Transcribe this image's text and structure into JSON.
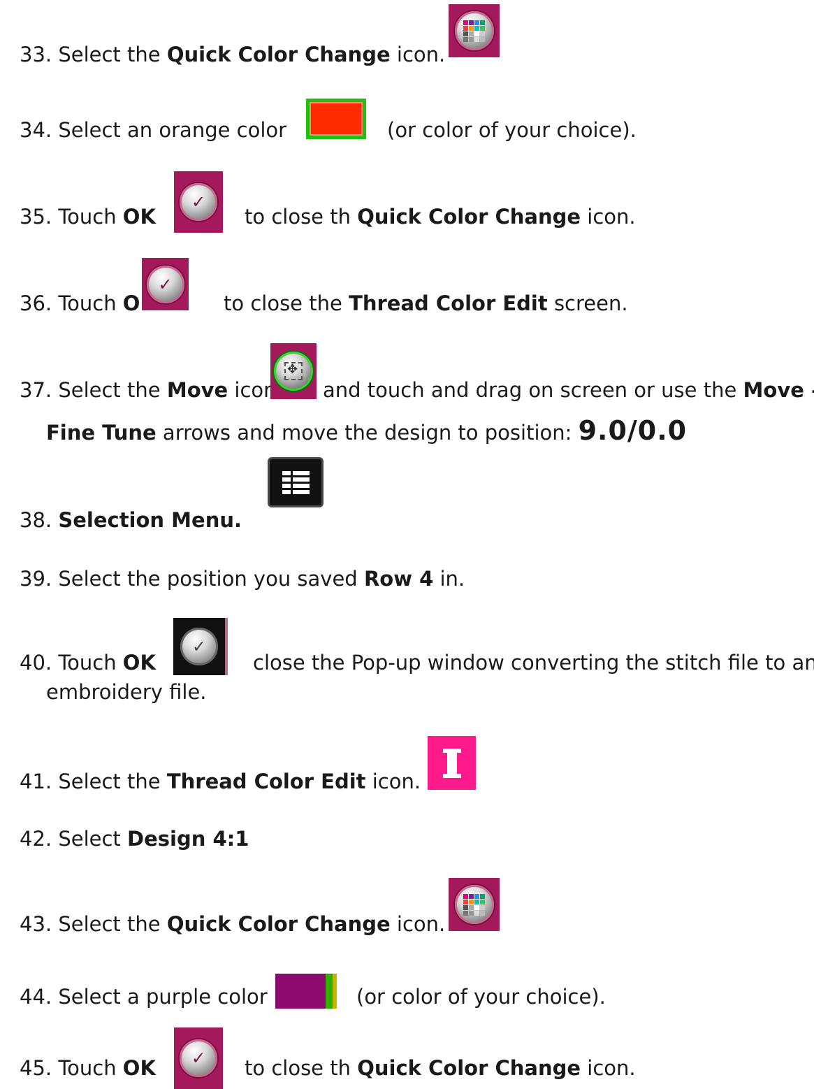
{
  "steps": [
    {
      "num": "33. ",
      "t1": "Select the ",
      "b1": "Quick Color Change",
      "t2": " icon."
    },
    {
      "num": "34. ",
      "t1": "Select an orange color",
      "t2": "(or color of your choice)."
    },
    {
      "num": "35. ",
      "t1": "Touch ",
      "b1": "OK",
      "t2": "to close th ",
      "b2": "Quick Color Change",
      "t3": " icon."
    },
    {
      "num": "36. ",
      "t1": "Touch ",
      "b1": "OK",
      "t2": "to close the ",
      "b2": "Thread Color Edit",
      "t3": " screen."
    },
    {
      "num": "37. ",
      "t1": "Select the ",
      "b1": "Move",
      "t2": " icon",
      "t3": "and touch and drag on screen or use the ",
      "b2": "Move –",
      "line2_b": "Fine Tune",
      "line2_t": " arrows and move the design to position:  ",
      "line2_big": "9.0/0.0"
    },
    {
      "num": "38. ",
      "b1": "Selection Menu."
    },
    {
      "num": "39. ",
      "t1": "Select the position you saved ",
      "b1": "Row 4",
      "t2": " in."
    },
    {
      "num": "40. ",
      "t1": "Touch ",
      "b1": "OK",
      "t2": "close the Pop-up window converting the stitch file to an",
      "line2": "embroidery file."
    },
    {
      "num": "41. ",
      "t1": "Select the ",
      "b1": "Thread Color Edit",
      "t2": " icon."
    },
    {
      "num": "42. ",
      "t1": "Select ",
      "b1": "Design 4:1"
    },
    {
      "num": "43. ",
      "t1": "Select the ",
      "b1": "Quick Color Change",
      "t2": " icon."
    },
    {
      "num": "44. ",
      "t1": "Select a purple  color",
      "t2": "(or color of your choice)."
    },
    {
      "num": "45. ",
      "t1": "Touch ",
      "b1": "OK",
      "t2": "to close th ",
      "b2": "Quick Color Change",
      "t3": " icon."
    }
  ],
  "icons": {
    "quick_color_change": "quick-color-change-icon",
    "ok": "ok-check-icon",
    "move": "move-icon",
    "selection_menu": "selection-menu-icon",
    "thread_color_edit": "thread-spool-icon"
  },
  "colors": {
    "tile_maroon": "#a3195b",
    "orange_swatch": "#ff2a00",
    "purple_swatch": "#8c0a6d",
    "spool_pink": "#ff1a8c",
    "green_highlight": "#22c10f"
  }
}
